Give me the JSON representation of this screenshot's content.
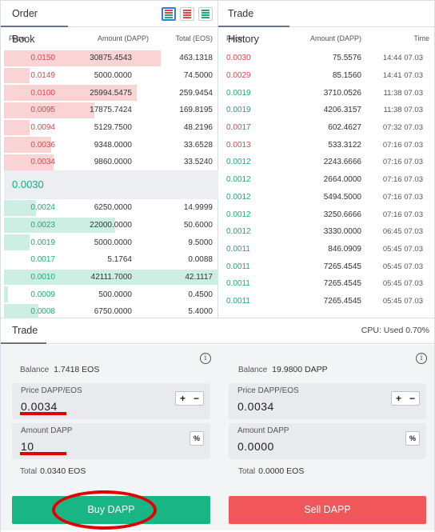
{
  "order_book": {
    "title": "Order Book",
    "columns": [
      "Price",
      "Amount (DAPP)",
      "Total (EOS)"
    ],
    "asks": [
      {
        "price": "0.0150",
        "amount": "30875.4543",
        "total": "463.1318",
        "depth": 0.73
      },
      {
        "price": "0.0149",
        "amount": "5000.0000",
        "total": "74.5000",
        "depth": 0.12
      },
      {
        "price": "0.0100",
        "amount": "25994.5475",
        "total": "259.9454",
        "depth": 0.62
      },
      {
        "price": "0.0095",
        "amount": "17875.7424",
        "total": "169.8195",
        "depth": 0.42
      },
      {
        "price": "0.0094",
        "amount": "5129.7500",
        "total": "48.2196",
        "depth": 0.12
      },
      {
        "price": "0.0036",
        "amount": "9348.0000",
        "total": "33.6528",
        "depth": 0.22
      },
      {
        "price": "0.0034",
        "amount": "9860.0000",
        "total": "33.5240",
        "depth": 0.23
      }
    ],
    "mid_price": "0.0030",
    "bids": [
      {
        "price": "0.0024",
        "amount": "6250.0000",
        "total": "14.9999",
        "depth": 0.15
      },
      {
        "price": "0.0023",
        "amount": "22000.0000",
        "total": "50.6000",
        "depth": 0.52
      },
      {
        "price": "0.0019",
        "amount": "5000.0000",
        "total": "9.5000",
        "depth": 0.12
      },
      {
        "price": "0.0017",
        "amount": "5.1764",
        "total": "0.0088",
        "depth": 0.0
      },
      {
        "price": "0.0010",
        "amount": "42111.7000",
        "total": "42.1117",
        "depth": 1.0
      },
      {
        "price": "0.0009",
        "amount": "500.0000",
        "total": "0.4500",
        "depth": 0.02
      },
      {
        "price": "0.0008",
        "amount": "6750.0000",
        "total": "5.4000",
        "depth": 0.16
      }
    ]
  },
  "trade_history": {
    "title": "Trade History",
    "columns": [
      "Price",
      "Amount (DAPP)",
      "Time"
    ],
    "rows": [
      {
        "price": "0.0030",
        "amount": "75.5576",
        "time": "14:44 07.03",
        "side": "down"
      },
      {
        "price": "0.0029",
        "amount": "85.1560",
        "time": "14:41 07.03",
        "side": "down"
      },
      {
        "price": "0.0019",
        "amount": "3710.0526",
        "time": "11:38 07.03",
        "side": "up"
      },
      {
        "price": "0.0019",
        "amount": "4206.3157",
        "time": "11:38 07.03",
        "side": "up"
      },
      {
        "price": "0.0017",
        "amount": "602.4627",
        "time": "07:32 07.03",
        "side": "down"
      },
      {
        "price": "0.0013",
        "amount": "533.3122",
        "time": "07:16 07.03",
        "side": "down"
      },
      {
        "price": "0.0012",
        "amount": "2243.6666",
        "time": "07:16 07.03",
        "side": "up"
      },
      {
        "price": "0.0012",
        "amount": "2664.0000",
        "time": "07:16 07.03",
        "side": "up"
      },
      {
        "price": "0.0012",
        "amount": "5494.5000",
        "time": "07:16 07.03",
        "side": "up"
      },
      {
        "price": "0.0012",
        "amount": "3250.6666",
        "time": "07:16 07.03",
        "side": "up"
      },
      {
        "price": "0.0012",
        "amount": "3330.0000",
        "time": "06:45 07.03",
        "side": "up"
      },
      {
        "price": "0.0011",
        "amount": "846.0909",
        "time": "05:45 07.03",
        "side": "up"
      },
      {
        "price": "0.0011",
        "amount": "7265.4545",
        "time": "05:45 07.03",
        "side": "up"
      },
      {
        "price": "0.0011",
        "amount": "7265.4545",
        "time": "05:45 07.03",
        "side": "up"
      },
      {
        "price": "0.0011",
        "amount": "7265.4545",
        "time": "05:45 07.03",
        "side": "up"
      }
    ]
  },
  "trade": {
    "title": "Trade",
    "cpu": "CPU: Used 0.70%",
    "info_icon": "i",
    "buy": {
      "balance_label": "Balance",
      "balance_value": "1.7418 EOS",
      "price_label": "Price DAPP/EOS",
      "price_value": "0.0034",
      "amount_label": "Amount DAPP",
      "amount_value": "10",
      "total_label": "Total",
      "total_value": "0.0340 EOS",
      "button": "Buy DAPP"
    },
    "sell": {
      "balance_label": "Balance",
      "balance_value": "19.9800 DAPP",
      "price_label": "Price DAPP/EOS",
      "price_value": "0.0034",
      "amount_label": "Amount DAPP",
      "amount_value": "0.0000",
      "total_label": "Total",
      "total_value": "0.0000 EOS",
      "button": "Sell DAPP"
    },
    "stepper_plus": "+",
    "stepper_minus": "−",
    "percent": "%"
  },
  "colors": {
    "ask": "#e0474c",
    "bid": "#1fa87b",
    "buy_button": "#19b585",
    "sell_button": "#f0565a",
    "annotation": "#e00000"
  }
}
